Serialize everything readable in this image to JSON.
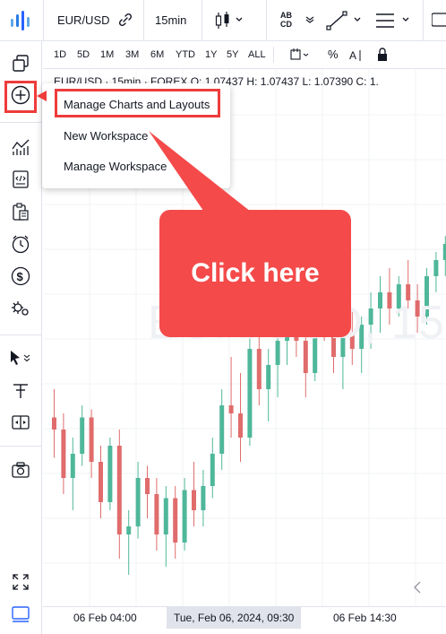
{
  "topbar": {
    "symbol": "EUR/USD",
    "interval": "15min",
    "compare_icon": "compare-link-icon",
    "chart_type_icon": "candles-icon",
    "indicator_label_top": "AB",
    "indicator_label_bottom": "CD"
  },
  "rangebar": {
    "ranges": [
      "1D",
      "5D",
      "1M",
      "3M",
      "6M",
      "YTD",
      "1Y",
      "5Y",
      "ALL"
    ]
  },
  "legend": {
    "text": "EUR/USD · 15min · FOREX   O: 1.07437  H: 1.07437  L: 1.07390  C: 1."
  },
  "watermark": "EUR/USD, 15",
  "menu": {
    "items": [
      "Manage Charts and Layouts",
      "New Workspace",
      "Manage Workspace"
    ]
  },
  "callout": {
    "text": "Click here"
  },
  "timeaxis": {
    "left_label": "06 Feb 04:00",
    "crosshair_label": "Tue, Feb 06, 2024, 09:30",
    "right_label": "06 Feb 14:30"
  },
  "colors": {
    "up": "#4fb79a",
    "down": "#e06c6c",
    "highlight": "#ee3b3b",
    "callout": "#f44a4a"
  },
  "chart_data": {
    "type": "candlestick",
    "series": [
      {
        "values": [
          [
            0.45,
            0.52,
            0.35,
            0.42
          ],
          [
            0.42,
            0.46,
            0.26,
            0.3
          ],
          [
            0.3,
            0.4,
            0.22,
            0.36
          ],
          [
            0.36,
            0.48,
            0.33,
            0.45
          ],
          [
            0.45,
            0.47,
            0.3,
            0.34
          ],
          [
            0.34,
            0.38,
            0.2,
            0.24
          ],
          [
            0.24,
            0.4,
            0.22,
            0.38
          ],
          [
            0.38,
            0.42,
            0.1,
            0.16
          ],
          [
            0.16,
            0.22,
            0.06,
            0.18
          ],
          [
            0.18,
            0.34,
            0.15,
            0.3
          ],
          [
            0.3,
            0.33,
            0.2,
            0.26
          ],
          [
            0.26,
            0.3,
            0.12,
            0.16
          ],
          [
            0.16,
            0.28,
            0.08,
            0.25
          ],
          [
            0.25,
            0.28,
            0.1,
            0.14
          ],
          [
            0.14,
            0.3,
            0.12,
            0.27
          ],
          [
            0.27,
            0.34,
            0.18,
            0.22
          ],
          [
            0.22,
            0.32,
            0.18,
            0.28
          ],
          [
            0.28,
            0.4,
            0.25,
            0.36
          ],
          [
            0.36,
            0.52,
            0.32,
            0.48
          ],
          [
            0.48,
            0.6,
            0.4,
            0.46
          ],
          [
            0.46,
            0.56,
            0.34,
            0.4
          ],
          [
            0.4,
            0.66,
            0.38,
            0.62
          ],
          [
            0.62,
            0.7,
            0.48,
            0.52
          ],
          [
            0.52,
            0.62,
            0.44,
            0.58
          ],
          [
            0.58,
            0.7,
            0.5,
            0.64
          ],
          [
            0.64,
            0.74,
            0.58,
            0.7
          ],
          [
            0.7,
            0.76,
            0.6,
            0.64
          ],
          [
            0.64,
            0.72,
            0.5,
            0.56
          ],
          [
            0.56,
            0.72,
            0.54,
            0.7
          ],
          [
            0.7,
            0.78,
            0.64,
            0.68
          ],
          [
            0.68,
            0.74,
            0.56,
            0.6
          ],
          [
            0.6,
            0.7,
            0.52,
            0.66
          ],
          [
            0.66,
            0.72,
            0.58,
            0.62
          ],
          [
            0.62,
            0.7,
            0.56,
            0.68
          ],
          [
            0.68,
            0.76,
            0.62,
            0.72
          ],
          [
            0.72,
            0.8,
            0.66,
            0.76
          ],
          [
            0.76,
            0.82,
            0.68,
            0.72
          ],
          [
            0.72,
            0.8,
            0.7,
            0.78
          ],
          [
            0.78,
            0.84,
            0.72,
            0.74
          ],
          [
            0.74,
            0.78,
            0.66,
            0.7
          ],
          [
            0.7,
            0.82,
            0.68,
            0.8
          ],
          [
            0.8,
            0.86,
            0.76,
            0.84
          ],
          [
            0.84,
            0.9,
            0.8,
            0.88
          ],
          [
            0.88,
            0.96,
            0.86,
            0.94
          ]
        ]
      }
    ]
  }
}
